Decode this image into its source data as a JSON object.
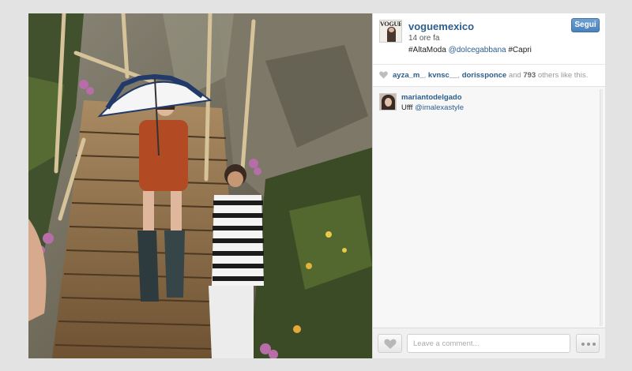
{
  "post": {
    "username": "voguemexico",
    "avatar_text": "VOGUE",
    "time_ago": "14 ore fa",
    "caption": [
      {
        "text": "#AltaModa",
        "type": "text"
      },
      {
        "text": " ",
        "type": "text"
      },
      {
        "text": "@dolcegabbana",
        "type": "mention"
      },
      {
        "text": " #Capri",
        "type": "text"
      }
    ],
    "follow_label": "Segui",
    "photo_alt": ""
  },
  "likes": {
    "users": [
      "ayza_m_",
      "kvnsc__",
      "dorissponce"
    ],
    "and_text": "and",
    "count": "793",
    "suffix": "others like this."
  },
  "comments": [
    {
      "user": "mariantodelgado",
      "text": "Ufff ",
      "mention": "@imalexastyle"
    }
  ],
  "footer": {
    "comment_placeholder": "Leave a comment..."
  },
  "colors": {
    "link": "#2c5e8e",
    "follow_button": "#5a8fc7",
    "page_bg": "#e3e3e3"
  },
  "icons": {
    "like": "heart-icon",
    "likes_row": "heart-icon",
    "more": "ellipsis-icon"
  }
}
